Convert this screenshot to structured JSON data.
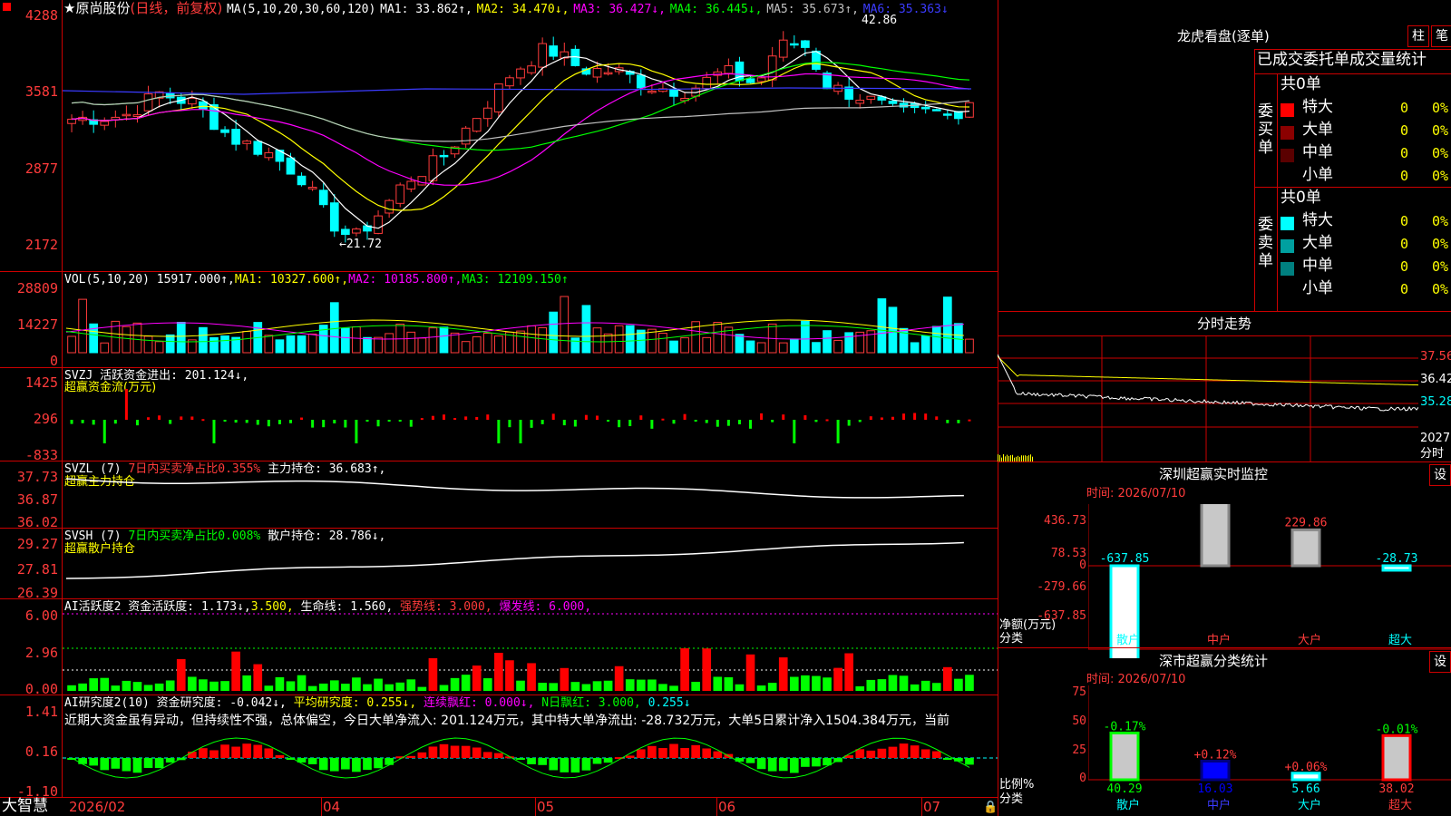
{
  "colors": {
    "up": "#ff3b3b",
    "down": "#00ffff",
    "ma1": "#ffffff",
    "ma2": "#ffff00",
    "ma3": "#ff00ff",
    "ma4": "#00ff00",
    "ma5": "#c0c0c0",
    "ma6": "#3b3bff",
    "frame": "#c00000"
  },
  "main": {
    "star": "★",
    "stock": "原尚股份",
    "period": "(日线，前复权)",
    "ma_label": "MA(5,10,20,30,60,120)",
    "ma1": "MA1: 33.862↑,",
    "ma2": "MA2: 34.470↓,",
    "ma3": "MA3: 36.427↓,",
    "ma4": "MA4: 36.445↓,",
    "ma5": "MA5: 35.673↑,",
    "ma6": "MA6: 35.363↓",
    "high_label": "42.86",
    "low_label": "←21.72",
    "y_ticks": [
      "4288",
      "3581",
      "2877",
      "2172"
    ]
  },
  "vol": {
    "label": "VOL(5,10,20)",
    "value": "15917.000↑,",
    "ma1": "MA1: 10327.600↑,",
    "ma2": "MA2: 10185.800↑,",
    "ma3": "MA3: 12109.150↑",
    "y_ticks": [
      "28809",
      "14227",
      "0"
    ]
  },
  "svzj": {
    "label": "SVZJ 活跃资金进出: 201.124↓,",
    "sub": "超赢资金流(万元)",
    "y_ticks": [
      "1425",
      "296",
      "-833"
    ]
  },
  "svzl": {
    "label": "SVZL (7)",
    "desc": "7日内买卖净占比0.355%",
    "value": "主力持仓: 36.683↑,",
    "sub": "超赢主力持仓",
    "y_ticks": [
      "37.73",
      "36.87",
      "36.02"
    ]
  },
  "svsh": {
    "label": "SVSH (7)",
    "desc": "7日内买卖净占比0.008%",
    "value": "散户持仓: 28.786↓,",
    "sub": "超赢散户持仓",
    "y_ticks": [
      "29.27",
      "27.81",
      "26.39"
    ]
  },
  "ai1": {
    "label": "AI活跃度2 资金活跃度: 1.173↓,",
    "v2": "3.500,",
    "v3": "生命线: 1.560,",
    "v4": "强势线: 3.000,",
    "v5": "爆发线: 6.000,",
    "y_ticks": [
      "6.00",
      "2.96",
      "0.00"
    ]
  },
  "ai2": {
    "label": "AI研究度2(10) 资金研究度: -0.042↓,",
    "v2": "平均研究度: 0.255↓,",
    "v3": "连续飘红: 0.000↓,",
    "v4": "N日飘红: 3.000,",
    "v5": "0.255↓",
    "note": "近期大资金虽有异动，但持续性不强，总体偏空，今日大单净流入: 201.124万元，其中特大单净流出: -28.732万元，大单5日累计净入1504.384万元，当前",
    "y_ticks": [
      "1.41",
      "0.16",
      "-1.10"
    ]
  },
  "dates": [
    "2026/02",
    "04",
    "05",
    "06",
    "07"
  ],
  "brand": "大智慧",
  "right": {
    "lhb_title": "龙虎看盘(逐单)",
    "btn1": "柱",
    "btn2": "笔",
    "table_header": "已成交委托单成交量统计",
    "buy_side": "委买单",
    "sell_side": "委卖单",
    "buy_total": "共0单",
    "sell_total": "共0单",
    "buy_rows": [
      {
        "name": "特大",
        "n": "0",
        "p": "0%",
        "color": "#ff0000"
      },
      {
        "name": "大单",
        "n": "0",
        "p": "0%",
        "color": "#8b0000"
      },
      {
        "name": "中单",
        "n": "0",
        "p": "0%",
        "color": "#5a0000"
      },
      {
        "name": "小单",
        "n": "0",
        "p": "0%",
        "color": ""
      }
    ],
    "sell_rows": [
      {
        "name": "特大",
        "n": "0",
        "p": "0%",
        "color": "#00ffff"
      },
      {
        "name": "大单",
        "n": "0",
        "p": "0%",
        "color": "#00a0a0"
      },
      {
        "name": "中单",
        "n": "0",
        "p": "0%",
        "color": "#008080"
      },
      {
        "name": "小单",
        "n": "0",
        "p": "0%",
        "color": ""
      }
    ],
    "intraday_title": "分时走势",
    "intraday_y": [
      "37.56",
      "36.42",
      "35.28",
      "2027"
    ],
    "intraday_unit": "分时",
    "monitor_title": "深圳超赢实时监控",
    "monitor_btn": "设",
    "monitor_time": "时间: 2026/07/10",
    "monitor_y": [
      "436.73",
      "78.53",
      "0",
      "-279.66",
      "-637.85"
    ],
    "monitor_axis": "净额(万元)",
    "monitor_axis2": "分类",
    "monitor_bars": [
      {
        "name": "散户",
        "value": -637.85,
        "label": "-637.85"
      },
      {
        "name": "中户",
        "value": 436.73,
        "label": "436.73"
      },
      {
        "name": "大户",
        "value": 229.86,
        "label": "229.86"
      },
      {
        "name": "超大",
        "value": -28.73,
        "label": "-28.73"
      }
    ],
    "stats_title": "深市超赢分类统计",
    "stats_btn": "设",
    "stats_time": "时间: 2026/07/10",
    "stats_y": [
      "75",
      "50",
      "25",
      "0"
    ],
    "stats_axis": "比例%",
    "stats_axis2": "分类",
    "stats_bars": [
      {
        "name": "散户",
        "value": 40.29,
        "label": "40.29",
        "change": "-0.17%"
      },
      {
        "name": "中户",
        "value": 16.03,
        "label": "16.03",
        "change": "+0.12%"
      },
      {
        "name": "大户",
        "value": 5.66,
        "label": "5.66",
        "change": "+0.06%"
      },
      {
        "name": "超大",
        "value": 38.02,
        "label": "38.02",
        "change": "-0.01%"
      }
    ]
  }
}
